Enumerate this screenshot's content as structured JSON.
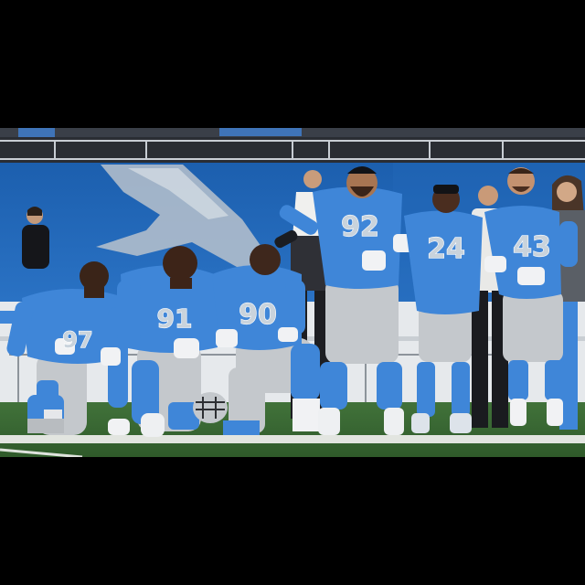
{
  "scene": {
    "jersey_numbers": [
      "97",
      "91",
      "90",
      "92",
      "24",
      "43"
    ],
    "colors": {
      "jersey_blue": "#3f86d8",
      "pants_silver": "#c4c8cc",
      "field_green": "#3e6b34",
      "wall_blue": "#1f63b4",
      "letterbox": "#000000"
    }
  }
}
